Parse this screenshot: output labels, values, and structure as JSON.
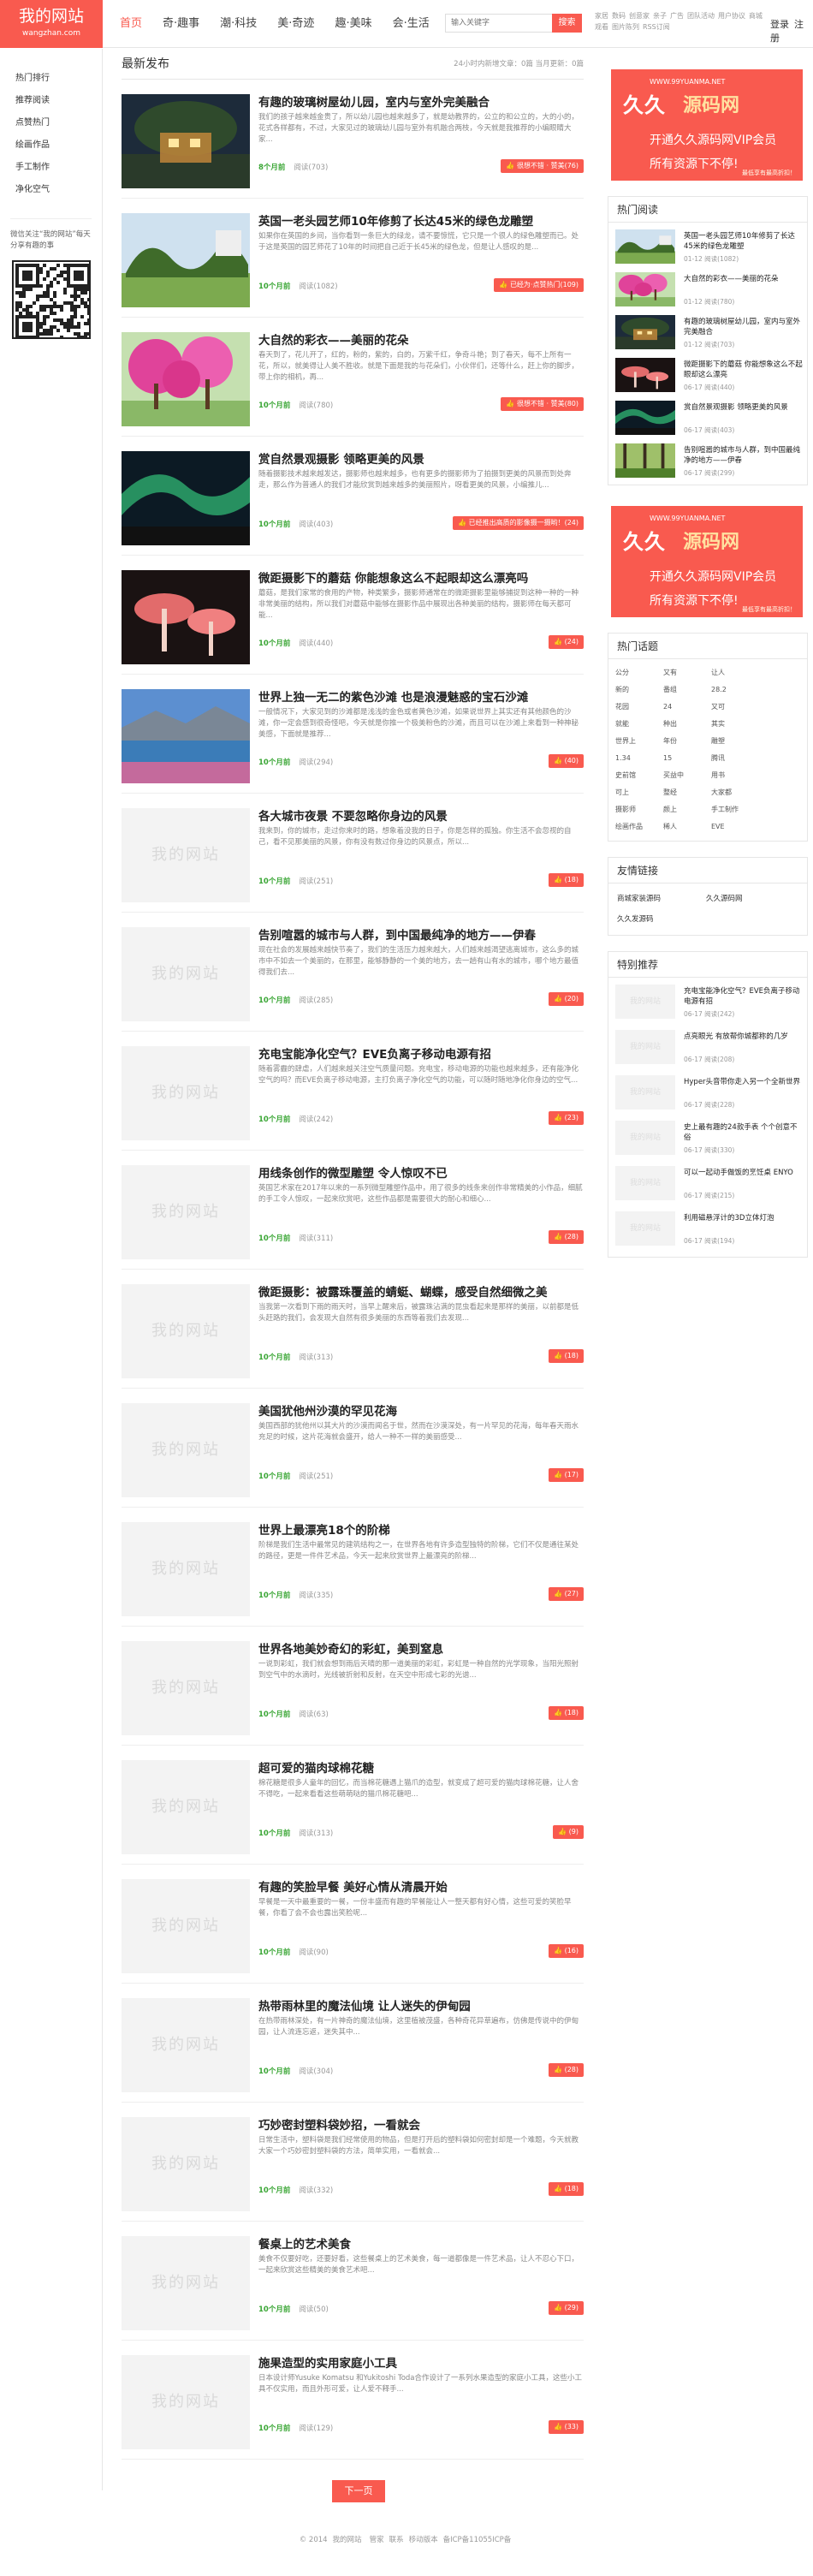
{
  "header": {
    "logo_title": "我的网站",
    "logo_sub": "wangzhan.com",
    "nav": [
      "首页",
      "奇·趣事",
      "潮·科技",
      "美·奇迹",
      "趣·美味",
      "会·生活"
    ],
    "search_placeholder": "输入关键字",
    "search_button": "搜索",
    "hotwords": [
      "家居",
      "数码",
      "创意家",
      "亲子",
      "广告",
      "团队活动",
      "用户协议",
      "商城",
      "观看",
      "图片陈列",
      "RSS订阅"
    ],
    "login": "登录",
    "register": "注册"
  },
  "left": {
    "menu": [
      "热门排行",
      "推荐阅读",
      "点赞热门",
      "绘画作品",
      "手工制作",
      "净化空气"
    ],
    "follow": "微信关注“我的网站”每天分享有趣的事"
  },
  "main": {
    "section_title": "最新发布",
    "stat": "24小时内新增文章：0篇    当月更新：0篇",
    "posts": [
      {
        "title": "有趣的玻璃树屋幼儿园，室内与室外完美融合",
        "excerpt": "我们的孩子越来越金贵了，所以幼儿园也越来越多了，就是幼教界的，公立的和公立的，大的小的，花式各样都有，不过，大家见过的玻璃幼儿园与室外有机融合两枝，今天就是我推荐的小编眼睛大家...",
        "tag": "8个月前",
        "views": "阅读(703)",
        "likes": "(76)",
        "like_label": "很想不错 · 赞美",
        "thumb": "tree"
      },
      {
        "title": "英国一老头园艺师10年修剪了长达45米的绿色龙雕塑",
        "excerpt": "如果你在英国的乡间，当你看到一条巨大的绿龙，请不要惊慌，它只是一个很人的绿色雕塑而已。处于这是英国的园艺师花了10年的时间把自己近于长45米的绿色龙，但是让人感叹的是...",
        "tag": "10个月前",
        "views": "阅读(1082)",
        "likes": "(109)",
        "like_label": "已经为·点赞热门",
        "thumb": "topiary"
      },
      {
        "title": "大自然的彩衣——美丽的花朵",
        "excerpt": "春天到了，花儿开了，红的，粉的，紫的，白的，万紫千红，争奇斗艳；到了春天，每不上所有一花，所以，就美得让人美不胜收。就是下面是我的与花朵们，小伙伴们，还等什么，赶上你的脚步，带上你的相机，再...",
        "tag": "10个月前",
        "views": "阅读(780)",
        "likes": "(80)",
        "like_label": "很想不错 · 赞美",
        "thumb": "pinktree"
      },
      {
        "title": "赏自然景观摄影 领略更美的风景",
        "excerpt": "随着摄影技术越来越发达，摄影师也越来越多，也有更多的摄影师为了拍摄到更美的风景而到处奔走，那么作为普通人的我们才能欣赏到越来越多的美丽照片，呀看更美的风景，小编推儿...",
        "tag": "10个月前",
        "views": "阅读(403)",
        "likes": "(24)",
        "like_label": "已经推出高质的影像摄一摄哟！",
        "thumb": "aurora"
      },
      {
        "title": "微距摄影下的蘑菇 你能想象这么不起眼却这么漂亮吗",
        "excerpt": "蘑菇，是我们家常的食用的产物，种类繁多，摄影师通常在的微距摄影里能够捕捉到这种一种的一种非常美丽的结构，所以我们对蘑菇中能够在摄影作品中展现出各种美丽的结构，摄影师在每天都可能...",
        "tag": "10个月前",
        "views": "阅读(440)",
        "likes": "(24)",
        "like_label": "",
        "thumb": "mushroom"
      },
      {
        "title": "世界上独一无二的紫色沙滩 也是浪漫魅惑的宝石沙滩",
        "excerpt": "一般情况下，大家见到的沙滩都是浅浅的金色或者黄色沙滩，如果说世界上其实还有其他颜色的沙滩，你一定会感到很奇怪吧，今天就是你推一个极美粉色的沙滩，而且可以在沙滩上来看到一种神秘美感，下面就是推荐...",
        "tag": "10个月前",
        "views": "阅读(294)",
        "likes": "(40)",
        "like_label": "",
        "thumb": "beach"
      },
      {
        "title": "各大城市夜景 不要忽略你身边的风景",
        "excerpt": "我来到，你的城市，走过你来时的路，想象着没我的日子，你是怎样的孤独。你生活不会忽视的自己，看不见那美丽的风景，你有没有数过你身边的风景点，所以...",
        "tag": "10个月前",
        "views": "阅读(251)",
        "likes": "(18)",
        "like_label": "",
        "thumb": ""
      },
      {
        "title": "告别喧嚣的城市与人群，到中国最纯净的地方——伊春",
        "excerpt": "现在社会的发展越来越快节奏了，我们的生活压力越来越大，人们越来越渴望逃离城市，这么多的城市中不如去一个美丽的，在那里，能够静静的一个美的地方，去一趟有山有水的城市，哪个地方最值得我们去...",
        "tag": "10个月前",
        "views": "阅读(285)",
        "likes": "(20)",
        "like_label": "",
        "thumb": ""
      },
      {
        "title": "充电宝能净化空气？EVE负离子移动电源有招",
        "excerpt": "随着雾霾的肆虐，人们越来越关注空气质量问题。充电宝，移动电源的功能也越来越多，还有能净化空气的吗？而EVE负离子移动电源，主打负离子净化空气的功能，可以随时随地净化你身边的空气...",
        "tag": "10个月前",
        "views": "阅读(242)",
        "likes": "(23)",
        "like_label": "",
        "thumb": ""
      },
      {
        "title": "用线条创作的微型雕塑 令人惊叹不已",
        "excerpt": "英国艺术家在2017年以来的一系列微型雕塑作品中，用了很多的线条来创作非常精美的小作品，细腻的手工令人惊叹，一起来欣赏吧，这些作品都是需要很大的耐心和细心...",
        "tag": "10个月前",
        "views": "阅读(311)",
        "likes": "(28)",
        "like_label": "",
        "thumb": ""
      },
      {
        "title": "微距摄影：被露珠覆盖的蜻蜓、蝴蝶，感受自然细微之美",
        "excerpt": "当我第一次看到下雨的雨天时，当早上醒来后，被露珠沾满的昆虫看起来是那样的美丽，以前都是低头赶路的我们，会发现大自然有很多美丽的东西等着我们去发现...",
        "tag": "10个月前",
        "views": "阅读(313)",
        "likes": "(18)",
        "like_label": "",
        "thumb": ""
      },
      {
        "title": "美国犹他州沙漠的罕见花海",
        "excerpt": "美国西部的犹他州以其大片的沙漠而闻名于世，然而在沙漠深处，有一片罕见的花海，每年春天雨水充足的时候，这片花海就会盛开，给人一种不一样的美丽感受...",
        "tag": "10个月前",
        "views": "阅读(251)",
        "likes": "(17)",
        "like_label": "",
        "thumb": ""
      },
      {
        "title": "世界上最漂亮18个的阶梯",
        "excerpt": "阶梯是我们生活中最常见的建筑结构之一，在世界各地有许多造型独特的阶梯，它们不仅是通往某处的路径，更是一件件艺术品，今天一起来欣赏世界上最漂亮的阶梯...",
        "tag": "10个月前",
        "views": "阅读(335)",
        "likes": "(27)",
        "like_label": "",
        "thumb": ""
      },
      {
        "title": "世界各地美妙奇幻的彩虹，美到窒息",
        "excerpt": "一说到彩虹，我们就会想到雨后天晴的那一道美丽的彩虹，彩虹是一种自然的光学现象，当阳光照射到空气中的水滴时，光线被折射和反射，在天空中形成七彩的光谱...",
        "tag": "10个月前",
        "views": "阅读(63)",
        "likes": "(18)",
        "like_label": "",
        "thumb": ""
      },
      {
        "title": "超可爱的猫肉球棉花糖",
        "excerpt": "棉花糖是很多人童年的回忆，而当棉花糖遇上猫爪的造型，就变成了超可爱的猫肉球棉花糖，让人舍不得吃，一起来看看这些萌萌哒的猫爪棉花糖吧...",
        "tag": "10个月前",
        "views": "阅读(313)",
        "likes": "(9)",
        "like_label": "",
        "thumb": ""
      },
      {
        "title": "有趣的笑脸早餐 美好心情从清晨开始",
        "excerpt": "早餐是一天中最重要的一餐，一份丰盛而有趣的早餐能让人一整天都有好心情，这些可爱的笑脸早餐，你看了会不会也露出笑脸呢...",
        "tag": "10个月前",
        "views": "阅读(90)",
        "likes": "(16)",
        "like_label": "",
        "thumb": ""
      },
      {
        "title": "热带雨林里的魔法仙境 让人迷失的伊甸园",
        "excerpt": "在热带雨林深处，有一片神奇的魔法仙境，这里植被茂盛，各种奇花异草遍布，仿佛是传说中的伊甸园，让人流连忘返，迷失其中...",
        "tag": "10个月前",
        "views": "阅读(304)",
        "likes": "(28)",
        "like_label": "",
        "thumb": ""
      },
      {
        "title": "巧妙密封塑料袋妙招，一看就会",
        "excerpt": "日常生活中，塑料袋是我们经常使用的物品，但是打开后的塑料袋如何密封却是一个难题，今天就教大家一个巧妙密封塑料袋的方法，简单实用，一看就会...",
        "tag": "10个月前",
        "views": "阅读(332)",
        "likes": "(18)",
        "like_label": "",
        "thumb": ""
      },
      {
        "title": "餐桌上的艺术美食",
        "excerpt": "美食不仅要好吃，还要好看，这些餐桌上的艺术美食，每一道都像是一件艺术品，让人不忍心下口，一起来欣赏这些精美的美食艺术吧...",
        "tag": "10个月前",
        "views": "阅读(50)",
        "likes": "(29)",
        "like_label": "",
        "thumb": ""
      },
      {
        "title": "施果造型的实用家庭小工具",
        "excerpt": "日本设计师Yusuke Komatsu 和Yukitoshi Toda合作设计了一系列水果造型的家庭小工具，这些小工具不仅实用，而且外形可爱，让人爱不释手...",
        "tag": "10个月前",
        "views": "阅读(129)",
        "likes": "(33)",
        "like_label": "",
        "thumb": ""
      }
    ],
    "placeholder_text": "我的网站",
    "next_label": "下一页"
  },
  "right": {
    "ad": {
      "url": "WWW.99YUANMA.NET",
      "brand1": "久久",
      "brand2": "源码网",
      "line1": "开通久久源码网VIP会员",
      "line2": "所有资源下不停!",
      "small": "最低享有最高折扣！"
    },
    "hot_title": "热门阅读",
    "hot": [
      {
        "title": "英国一老头园艺师10年修剪了长达45米的绿色龙雕塑",
        "meta": "01-12    阅读(1082)",
        "thumb": "topiary"
      },
      {
        "title": "大自然的彩衣——美丽的花朵",
        "meta": "01-12    阅读(780)",
        "thumb": "pinktree"
      },
      {
        "title": "有趣的玻璃树屋幼儿园，室内与室外完美融合",
        "meta": "01-12    阅读(703)",
        "thumb": "tree"
      },
      {
        "title": "微距摄影下的蘑菇 你能想象这么不起眼却这么漂亮",
        "meta": "06-17    阅读(440)",
        "thumb": "mushroom"
      },
      {
        "title": "赏自然景观摄影 领略更美的风景",
        "meta": "06-17    阅读(403)",
        "thumb": "aurora"
      },
      {
        "title": "告别喧嚣的城市与人群，到中国最纯净的地方——伊春",
        "meta": "06-17    阅读(299)",
        "thumb": "forest"
      }
    ],
    "tags_title": "热门话题",
    "tags": [
      [
        "公分",
        "又有",
        "让人",
        ""
      ],
      [
        "新的",
        "番组",
        "28.2",
        ""
      ],
      [
        "花园",
        "24",
        "又可",
        ""
      ],
      [
        "就能",
        "种出",
        "其实",
        ""
      ],
      [
        "世界上",
        "年份",
        "雕塑",
        ""
      ],
      [
        "1.34",
        "15",
        "腾讯",
        ""
      ],
      [
        "史前馆",
        "买益中",
        "用书",
        ""
      ],
      [
        "可上",
        "整经",
        "大家都",
        ""
      ],
      [
        "摄影师",
        "颜上",
        "手工制作",
        ""
      ],
      [
        "绘画作品",
        "稀人",
        "EVE",
        ""
      ]
    ],
    "links_title": "友情链接",
    "links": [
      "商城家装源码",
      "久久源码网",
      "久久发源码"
    ],
    "rec_title": "特别推荐",
    "rec": [
      {
        "title": "充电宝能净化空气？EVE负离子移动电源有招",
        "meta": "06-17    阅读(242)"
      },
      {
        "title": "点亮眼光 有放帮你城都称的几岁",
        "meta": "06-17    阅读(208)"
      },
      {
        "title": "Hyper头音带你走入另一个全新世界",
        "meta": "06-17    阅读(228)"
      },
      {
        "title": "史上最有趣的24款手表 个个创意不俗",
        "meta": "06-17    阅读(330)"
      },
      {
        "title": "可以一起动手做饭的烹饪桌 ENYO",
        "meta": "06-17    阅读(215)"
      },
      {
        "title": "利用磁悬浮计的3D立体灯泡",
        "meta": "06-17    阅读(194)"
      }
    ]
  },
  "footer": {
    "copy": "© 2014",
    "site": "我的网站",
    "items": [
      "管家",
      "联系",
      "移动版本",
      "备ICP备11055ICP备"
    ]
  }
}
